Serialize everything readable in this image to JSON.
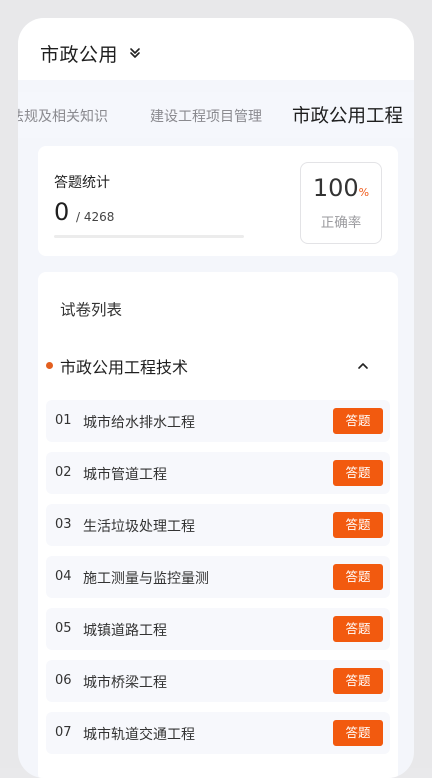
{
  "header": {
    "title": "市政公用",
    "chevron_icon": "double-chevron-down-icon"
  },
  "tabs": [
    {
      "label": "法规及相关知识"
    },
    {
      "label": "建设工程项目管理"
    },
    {
      "label": "市政公用工程"
    }
  ],
  "stats": {
    "label": "答题统计",
    "answered": "0",
    "total": "/ 4268",
    "progress": 0,
    "accuracy_value": "100",
    "accuracy_unit": "%",
    "accuracy_label": "正确率"
  },
  "papers": {
    "title": "试卷列表",
    "section": {
      "title": "市政公用工程技术",
      "chevron_icon": "chevron-up-icon"
    },
    "items": [
      {
        "num": "01",
        "name": "城市给水排水工程",
        "button": "答题"
      },
      {
        "num": "02",
        "name": "城市管道工程",
        "button": "答题"
      },
      {
        "num": "03",
        "name": "生活垃圾处理工程",
        "button": "答题"
      },
      {
        "num": "04",
        "name": "施工测量与监控量测",
        "button": "答题"
      },
      {
        "num": "05",
        "name": "城镇道路工程",
        "button": "答题"
      },
      {
        "num": "06",
        "name": "城市桥梁工程",
        "button": "答题"
      },
      {
        "num": "07",
        "name": "城市轨道交通工程",
        "button": "答题"
      }
    ]
  },
  "colors": {
    "accent": "#f25a0f",
    "dot": "#e35f1f"
  }
}
